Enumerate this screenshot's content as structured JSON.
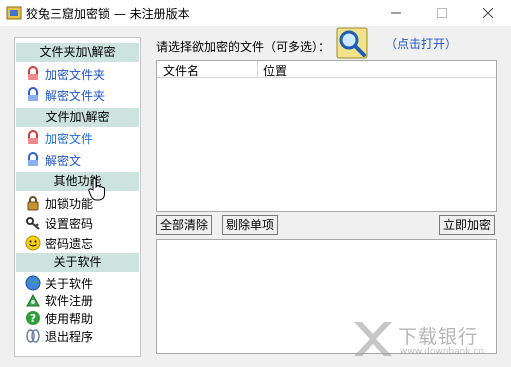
{
  "window": {
    "title": "狡兔三窟加密锁 — 未注册版本",
    "controls": [
      "minimize",
      "maximize",
      "close"
    ]
  },
  "sidebar": {
    "sections": [
      {
        "header": "文件夹加\\解密",
        "items": [
          {
            "label": "加密文件夹",
            "icon": "lock-red-icon"
          },
          {
            "label": "解密文件夹",
            "icon": "lock-blue-icon"
          }
        ]
      },
      {
        "header": "文件加\\解密",
        "items": [
          {
            "label": "加密文件",
            "icon": "lock-red-icon"
          },
          {
            "label": "解密文",
            "icon": "lock-blue-icon"
          }
        ]
      },
      {
        "header": "其他功能",
        "items": [
          {
            "label": "加锁功能",
            "icon": "padlock-icon"
          },
          {
            "label": "设置密码",
            "icon": "key-icon"
          },
          {
            "label": "密码遗忘",
            "icon": "smiley-icon"
          }
        ]
      },
      {
        "header": "关于软件",
        "items": [
          {
            "label": "关于软件",
            "icon": "globe-icon"
          },
          {
            "label": "软件注册",
            "icon": "register-icon"
          },
          {
            "label": "使用帮助",
            "icon": "help-icon"
          },
          {
            "label": "退出程序",
            "icon": "exit-icon"
          }
        ]
      }
    ]
  },
  "main": {
    "prompt": "请选择欲加密的文件（可多选）：",
    "open_link": "（点击打开）",
    "columns": [
      "文件名",
      "位置"
    ],
    "buttons": {
      "clear_all": "全部清除",
      "remove_item": "剔除单项",
      "encrypt_now": "立即加密"
    }
  },
  "watermark": {
    "brand": "下载银行",
    "url": "www.downbank.cn"
  },
  "colors": {
    "section_header": "#cde3dd",
    "link_blue": "#1f56c6",
    "hover_blue": "#1e6fd0"
  }
}
